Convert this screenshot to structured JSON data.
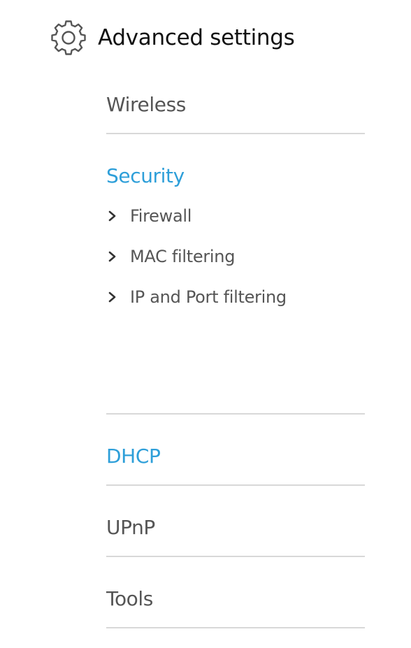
{
  "header": {
    "icon": "gear-icon",
    "title": "Advanced settings"
  },
  "menu": {
    "wireless": {
      "label": "Wireless"
    },
    "security": {
      "label": "Security",
      "items": [
        {
          "label": "Firewall",
          "icon": "chevron-right-icon"
        },
        {
          "label": "MAC filtering",
          "icon": "chevron-right-icon"
        },
        {
          "label": "IP and Port filtering",
          "icon": "chevron-right-icon"
        }
      ]
    },
    "dhcp": {
      "label": "DHCP"
    },
    "upnp": {
      "label": "UPnP"
    },
    "tools": {
      "label": "Tools"
    }
  },
  "colors": {
    "active": "#2e9fd9",
    "text": "#555555",
    "heading": "#111111",
    "divider": "#d8d8d8"
  }
}
